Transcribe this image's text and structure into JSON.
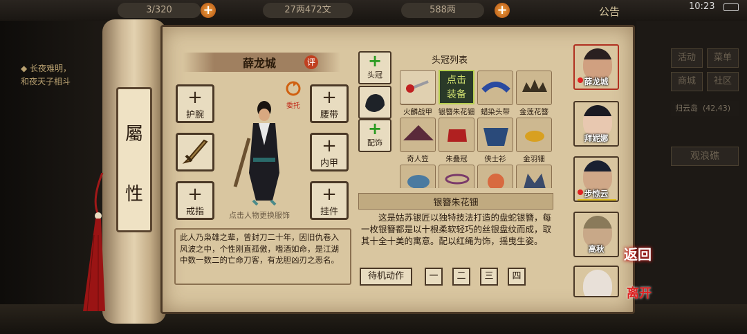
{
  "topbar": {
    "count": "3/320",
    "coins": "27两472文",
    "silver": "588两",
    "announce": "公告",
    "time": "10:23"
  },
  "quest": {
    "line1": "◆ 长夜难明，",
    "line2": "和夜天子相斗"
  },
  "scroll": {
    "label1": "屬",
    "label2": "性"
  },
  "character": {
    "name": "薛龙城",
    "review": "评",
    "entrust": "委托",
    "hint": "点击人物更换服饰",
    "bio": "此人乃枭雄之辈，曾封刀二十年，因旧仇卷入风波之中，个性刚直孤傲，嗜酒如命，是江湖中数一数二的亡命刀客，有龙胆凶刃之恶名。"
  },
  "slots": {
    "wrist": "护腕",
    "belt": "腰带",
    "armor": "内甲",
    "ring": "戒指",
    "pendant": "挂件",
    "plus": "+"
  },
  "equip_tabs": {
    "hat": "头冠",
    "acc": "配饰",
    "plus": "+"
  },
  "hat_list": {
    "title": "头冠列表",
    "equip_btn_1": "点击",
    "equip_btn_2": "装备",
    "items": [
      "火麟战甲",
      "银簪朱花钿",
      "蜡染头带",
      "金莲花簪",
      "奇人笠",
      "朱叠冠",
      "侠士衫",
      "金羽钿"
    ]
  },
  "desc": {
    "title": "银簪朱花钿",
    "text": "这是姑苏银匠以独特技法打造的盘蛇银簪，每一枚银簪都是以十根柔软轻巧的丝银盘纹而成，取其十全十美的寓意。配以红绳为饰，摇曳生姿。"
  },
  "idle": {
    "label": "待机动作",
    "n1": "一",
    "n2": "二",
    "n3": "三",
    "n4": "四"
  },
  "party": [
    "薛龙城",
    "拜妮娜",
    "步惊云",
    "高秋"
  ],
  "right_menu": {
    "activity": "活动",
    "menu": "菜单",
    "shop": "商城",
    "community": "社区",
    "location": "归云岛",
    "coords": "(42,43)",
    "spot": "观浪礁"
  },
  "actions": {
    "return": "返回",
    "leave": "离开"
  },
  "colors": {
    "panel": "#d9c6a0",
    "border": "#4a3826",
    "accent_red": "#c04020",
    "plus_green": "#2a9a20"
  }
}
